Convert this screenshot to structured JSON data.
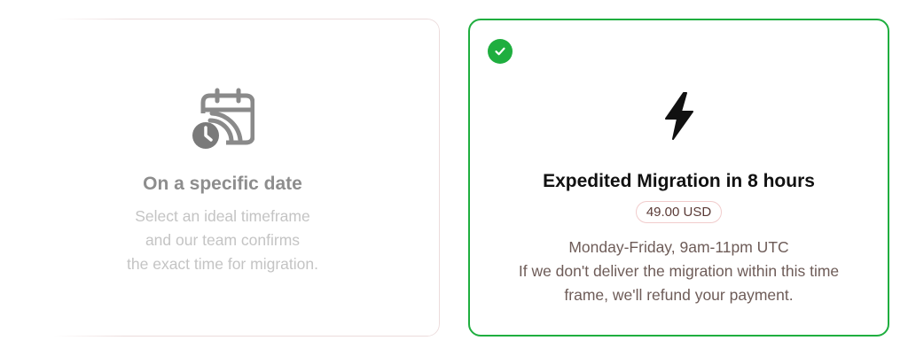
{
  "options": {
    "specific_date": {
      "title": "On a specific date",
      "description_lines": [
        "Select an ideal timeframe",
        "and our team confirms",
        "the exact time for migration."
      ],
      "icon": "calendar-clock-icon",
      "selected": false
    },
    "expedited": {
      "title": "Expedited Migration in 8 hours",
      "price": "49.00 USD",
      "description_lines": [
        "Monday-Friday, 9am-11pm UTC",
        "If we don't deliver the migration within this time",
        "frame, we'll refund your payment."
      ],
      "icon": "lightning-bolt-icon",
      "selected": true
    }
  },
  "colors": {
    "selected_border": "#1fae3f",
    "check_badge": "#1fae3f",
    "price_border": "#f1cccc",
    "unselected_border": "#ecdcdc"
  }
}
